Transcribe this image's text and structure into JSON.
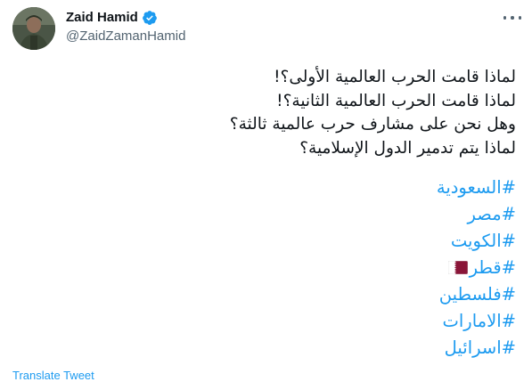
{
  "author": {
    "display_name": "Zaid Hamid",
    "handle": "@ZaidZamanHamid",
    "verified": true
  },
  "tweet": {
    "lines": [
      "لماذا قامت الحرب العالمية الأولى؟!",
      "لماذا قامت الحرب العالمية الثانية؟!",
      "وهل نحن على مشارف حرب عالمية ثالثة؟",
      "لماذا يتم تدمير الدول الإسلامية؟"
    ],
    "hashtags": [
      {
        "text": "#السعودية"
      },
      {
        "text": "#مصر"
      },
      {
        "text": "#الكويت"
      },
      {
        "text": "#قطر",
        "flag": "qatar-flag"
      },
      {
        "text": "#فلسطين"
      },
      {
        "text": "#الامارات"
      },
      {
        "text": "#اسرائيل"
      }
    ],
    "translate_label": "Translate Tweet"
  },
  "colors": {
    "link": "#1d9bf0",
    "text": "#0f1419",
    "secondary": "#536471",
    "verified": "#1d9bf0",
    "qatar_maroon": "#8a1538"
  },
  "icons": {
    "verified": "verified-badge-icon",
    "more": "more-options-icon"
  }
}
